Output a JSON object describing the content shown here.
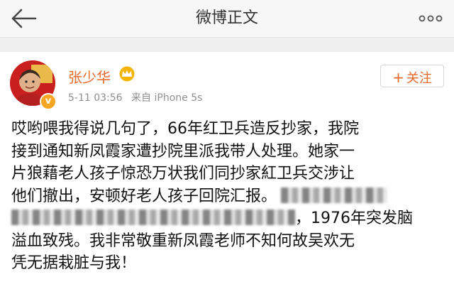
{
  "nav": {
    "title": "微博正文",
    "back_icon": "back-arrow-icon",
    "more_icon": "more-dots-icon"
  },
  "post": {
    "author": "张少华",
    "author_color": "#e8682a",
    "badge_icon": "crown-icon",
    "verified_badge": "v",
    "date": "5-11 03:56",
    "source": "来自 iPhone 5s",
    "follow_label": "关注",
    "follow_plus": "+",
    "lines": [
      "哎哟喂我得说几句了，66年红卫兵造反抄家，我院",
      "接到通知新凤霞家遭抄院里派我带人处理。她家一",
      "片狼藉老人孩子惊恐万状我们同抄家紅卫兵交涉让",
      "他们撤出，安顿好老人孩子回院汇报。",
      "，1976年突发脑",
      "溢血致残。我非常敬重新凤霞老师不知何故吴欢无",
      "凭无据栽脏与我！"
    ]
  }
}
